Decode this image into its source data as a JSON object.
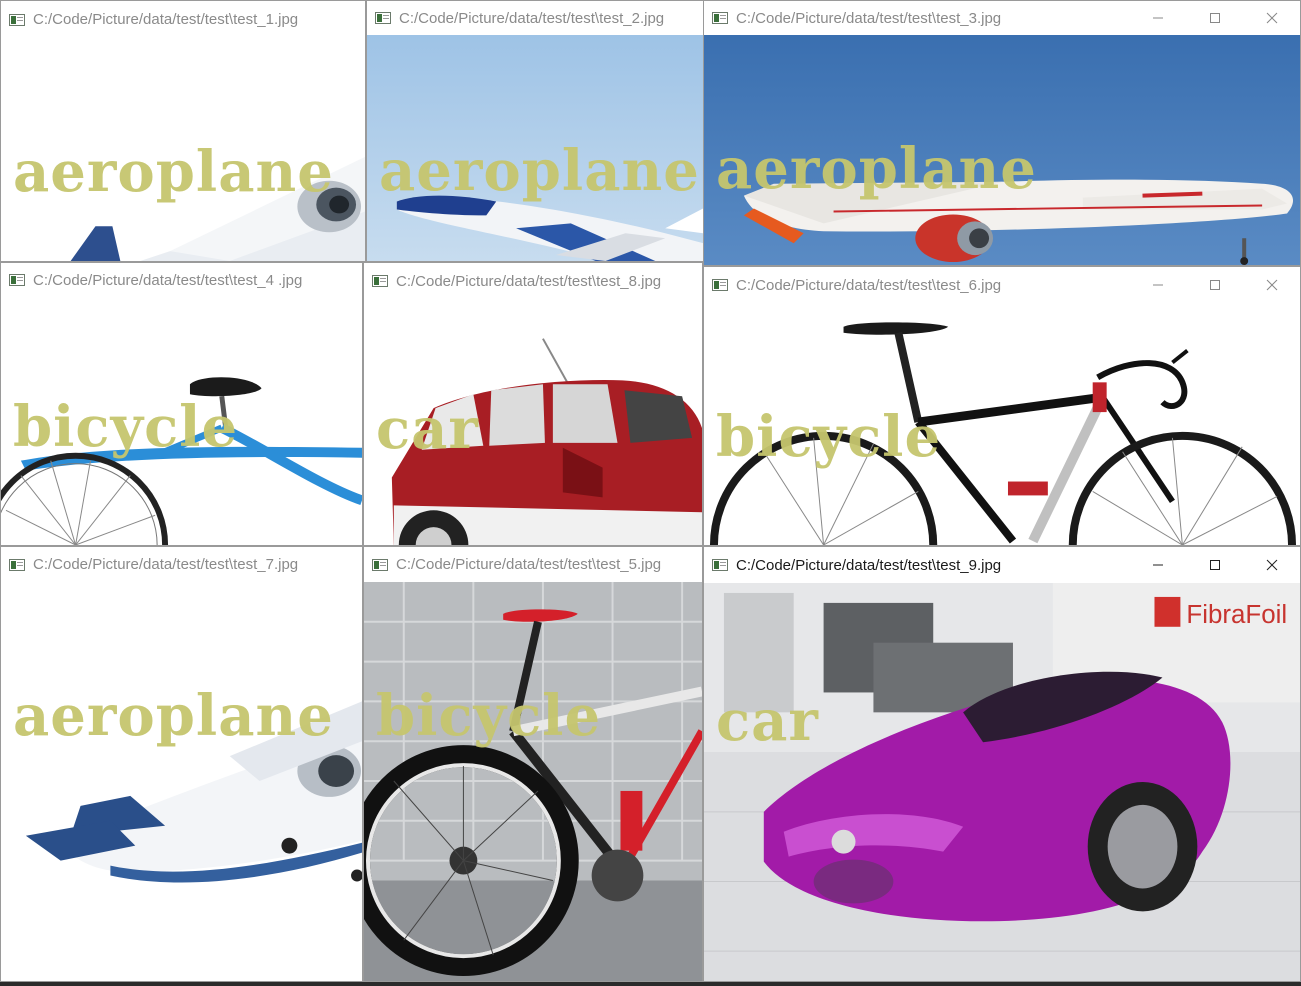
{
  "windows": [
    {
      "title": "C:/Code/Picture/data/test/test\\test_1.jpg",
      "label": "aeroplane"
    },
    {
      "title": "C:/Code/Picture/data/test/test\\test_2.jpg",
      "label": "aeroplane"
    },
    {
      "title": "C:/Code/Picture/data/test/test\\test_3.jpg",
      "label": "aeroplane"
    },
    {
      "title": "C:/Code/Picture/data/test/test\\test_4 .jpg",
      "label": "bicycle"
    },
    {
      "title": "C:/Code/Picture/data/test/test\\test_8.jpg",
      "label": "car"
    },
    {
      "title": "C:/Code/Picture/data/test/test\\test_6.jpg",
      "label": "bicycle"
    },
    {
      "title": "C:/Code/Picture/data/test/test\\test_7.jpg",
      "label": "aeroplane"
    },
    {
      "title": "C:/Code/Picture/data/test/test\\test_5.jpg",
      "label": "bicycle"
    },
    {
      "title": "C:/Code/Picture/data/test/test\\test_9.jpg",
      "label": "car"
    }
  ],
  "window_controls": {
    "minimize": "minimize-icon",
    "maximize": "maximize-icon",
    "close": "close-icon"
  },
  "label_color": "#c6c66e",
  "photo_text": {
    "brand_sign": "FibraFoil"
  }
}
